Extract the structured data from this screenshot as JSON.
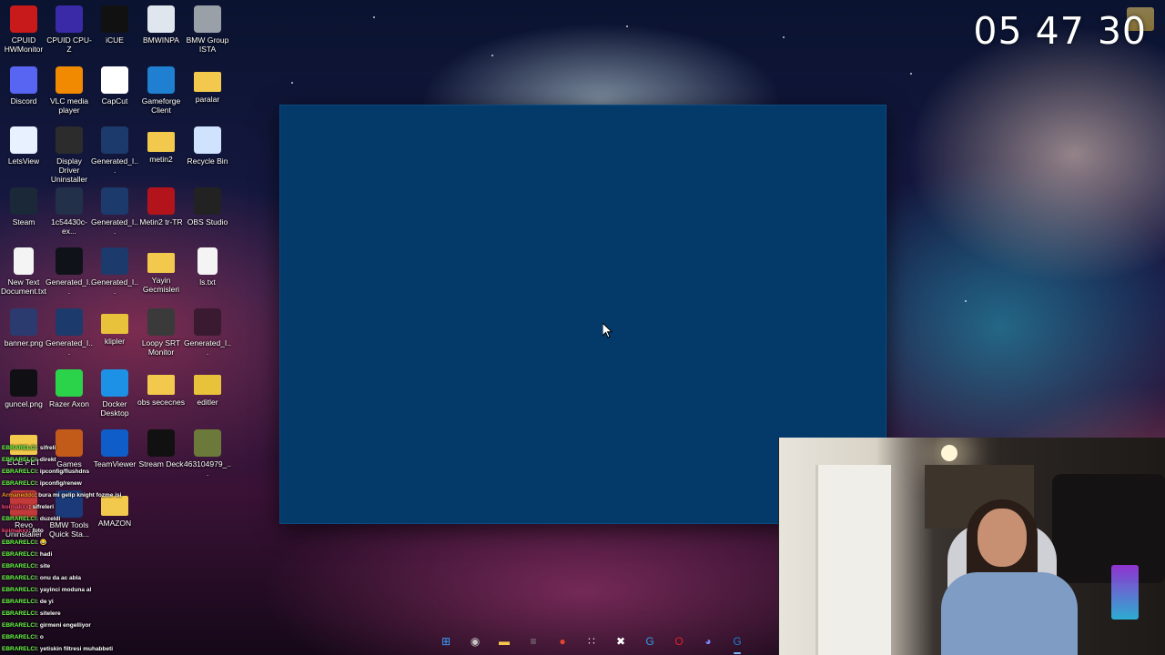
{
  "clock": {
    "time": "05 47 30"
  },
  "desktop_icons": [
    {
      "label": "CPUID HWMonitor",
      "icon": "hwmonitor-icon",
      "color": "#c81a1a"
    },
    {
      "label": "CPUID CPU-Z",
      "icon": "cpuz-icon",
      "color": "#3a2aa8"
    },
    {
      "label": "iCUE",
      "icon": "icue-icon",
      "color": "#111111"
    },
    {
      "label": "BMWINPA",
      "icon": "bmw-icon",
      "color": "#dfe6ee"
    },
    {
      "label": "BMW Group ISTA",
      "icon": "ista-icon",
      "color": "#9aa0a8"
    },
    {
      "label": "Discord",
      "icon": "discord-icon",
      "color": "#5865f2"
    },
    {
      "label": "VLC media player",
      "icon": "vlc-icon",
      "color": "#f18a00"
    },
    {
      "label": "CapCut",
      "icon": "capcut-icon",
      "color": "#ffffff"
    },
    {
      "label": "Gameforge Client",
      "icon": "gameforge-icon",
      "color": "#1f7fd1"
    },
    {
      "label": "paralar",
      "icon": "folder-icon",
      "color": "#f2c94c"
    },
    {
      "label": "LetsView",
      "icon": "letsview-icon",
      "color": "#e7f1ff"
    },
    {
      "label": "Display Driver Uninstaller",
      "icon": "ddu-icon",
      "color": "#2c2c2c"
    },
    {
      "label": "Generated_I...",
      "icon": "image-icon",
      "color": "#1c3a6b"
    },
    {
      "label": "metin2",
      "icon": "folder-icon",
      "color": "#f2c94c"
    },
    {
      "label": "Recycle Bin",
      "icon": "recycle-bin-icon",
      "color": "#cfe3ff"
    },
    {
      "label": "Steam",
      "icon": "steam-icon",
      "color": "#1b2838"
    },
    {
      "label": "1c54430c-ex...",
      "icon": "image-icon",
      "color": "#22304a"
    },
    {
      "label": "Generated_I...",
      "icon": "image-icon",
      "color": "#1c3a6b"
    },
    {
      "label": "Metin2 tr-TR",
      "icon": "metin2-icon",
      "color": "#b3141c"
    },
    {
      "label": "OBS Studio",
      "icon": "obs-icon",
      "color": "#222222"
    },
    {
      "label": "New Text Document.txt",
      "icon": "text-file-icon",
      "color": "#f4f4f4"
    },
    {
      "label": "Generated_I...",
      "icon": "image-icon",
      "color": "#10121a"
    },
    {
      "label": "Generated_I...",
      "icon": "image-icon",
      "color": "#1c3a6b"
    },
    {
      "label": "Yayin Gecmisleri",
      "icon": "folder-icon",
      "color": "#f2c94c"
    },
    {
      "label": "ls.txt",
      "icon": "text-file-icon",
      "color": "#f4f4f4"
    },
    {
      "label": "banner.png",
      "icon": "image-icon",
      "color": "#2b3b70"
    },
    {
      "label": "Generated_I...",
      "icon": "image-icon",
      "color": "#1c3a6b"
    },
    {
      "label": "klipler",
      "icon": "folder-icon",
      "color": "#e8c23a"
    },
    {
      "label": "Loopy SRT Monitor",
      "icon": "srt-icon",
      "color": "#3a3a3a"
    },
    {
      "label": "Generated_I...",
      "icon": "image-icon",
      "color": "#3a1a30"
    },
    {
      "label": "guncel.png",
      "icon": "image-icon",
      "color": "#0f0f14"
    },
    {
      "label": "Razer Axon",
      "icon": "razer-icon",
      "color": "#2bd34a"
    },
    {
      "label": "Docker Desktop",
      "icon": "docker-icon",
      "color": "#1d91e6"
    },
    {
      "label": "obs sececnes",
      "icon": "folder-icon",
      "color": "#f2c94c"
    },
    {
      "label": "editler",
      "icon": "folder-icon",
      "color": "#e8c23a"
    },
    {
      "label": "ECE PET",
      "icon": "folder-icon",
      "color": "#f2c94c"
    },
    {
      "label": "Games",
      "icon": "games-icon",
      "color": "#c25a1a"
    },
    {
      "label": "TeamViewer",
      "icon": "teamviewer-icon",
      "color": "#0e5dc8"
    },
    {
      "label": "Stream Deck",
      "icon": "stream-deck-icon",
      "color": "#111111"
    },
    {
      "label": "463104979_...",
      "icon": "image-icon",
      "color": "#6b7a3a"
    },
    {
      "label": "Revo Uninstaller",
      "icon": "revo-icon",
      "color": "#c23a3a"
    },
    {
      "label": "BMW Tools Quick Sta...",
      "icon": "cs-icon",
      "color": "#1a3a7a"
    },
    {
      "label": "AMAZON",
      "icon": "folder-icon",
      "color": "#f2c94c"
    }
  ],
  "chat": [
    {
      "user": "EBRARELCI",
      "msg": ": sifreli",
      "tone": "green"
    },
    {
      "user": "EBRARELCI",
      "msg": ": direkt",
      "tone": "green"
    },
    {
      "user": "EBRARELCI",
      "msg": ": ipconfig/flushdns",
      "tone": "green"
    },
    {
      "user": "EBRARELCI",
      "msg": ": ipconfig/renew",
      "tone": "green"
    },
    {
      "user": "Armaneddo",
      "msg": ": bura mi gelip knight fozme isi",
      "tone": "alt"
    },
    {
      "user": "koimakxx",
      "msg": ": sifreleri",
      "tone": "red"
    },
    {
      "user": "EBRARELCI",
      "msg": ": duzeldi",
      "tone": "green"
    },
    {
      "user": "koimakxx",
      "msg": ": foto",
      "tone": "red"
    },
    {
      "user": "EBRARELCI",
      "msg": ": 😂",
      "tone": "green"
    },
    {
      "user": "EBRARELCI",
      "msg": ": hadi",
      "tone": "green"
    },
    {
      "user": "EBRARELCI",
      "msg": ": site",
      "tone": "green"
    },
    {
      "user": "EBRARELCI",
      "msg": ": onu da ac abla",
      "tone": "green"
    },
    {
      "user": "EBRARELCI",
      "msg": ": yayinci moduna al",
      "tone": "green"
    },
    {
      "user": "EBRARELCI",
      "msg": ": de yi",
      "tone": "green"
    },
    {
      "user": "EBRARELCI",
      "msg": ": sitelere",
      "tone": "green"
    },
    {
      "user": "EBRARELCI",
      "msg": ": girmeni engelliyor",
      "tone": "green"
    },
    {
      "user": "EBRARELCI",
      "msg": ": o",
      "tone": "green"
    },
    {
      "user": "EBRARELCI",
      "msg": ": yetiskin filtresi muhabbeti",
      "tone": "green"
    }
  ],
  "taskbar": [
    {
      "name": "start-icon",
      "glyph": "⊞",
      "color": "#3aa0ff"
    },
    {
      "name": "davinci-icon",
      "glyph": "◉",
      "color": "#c6c6c6"
    },
    {
      "name": "file-explorer-icon",
      "glyph": "▬",
      "color": "#f2c94c"
    },
    {
      "name": "srt-app-icon",
      "glyph": "≡",
      "color": "#8a8a8a"
    },
    {
      "name": "chrome-icon",
      "glyph": "●",
      "color": "#e6452f"
    },
    {
      "name": "grid-app-icon",
      "glyph": "∷",
      "color": "#dddddd"
    },
    {
      "name": "capcut-taskbar-icon",
      "glyph": "✖",
      "color": "#ffffff"
    },
    {
      "name": "g-app-icon",
      "glyph": "G",
      "color": "#2aa1e8"
    },
    {
      "name": "opera-icon",
      "glyph": "O",
      "color": "#e0202a"
    },
    {
      "name": "discord-taskbar-icon",
      "glyph": "◕",
      "color": "#7a86ff"
    },
    {
      "name": "gameforge-taskbar-icon",
      "glyph": "G",
      "color": "#1f7fd1"
    }
  ]
}
